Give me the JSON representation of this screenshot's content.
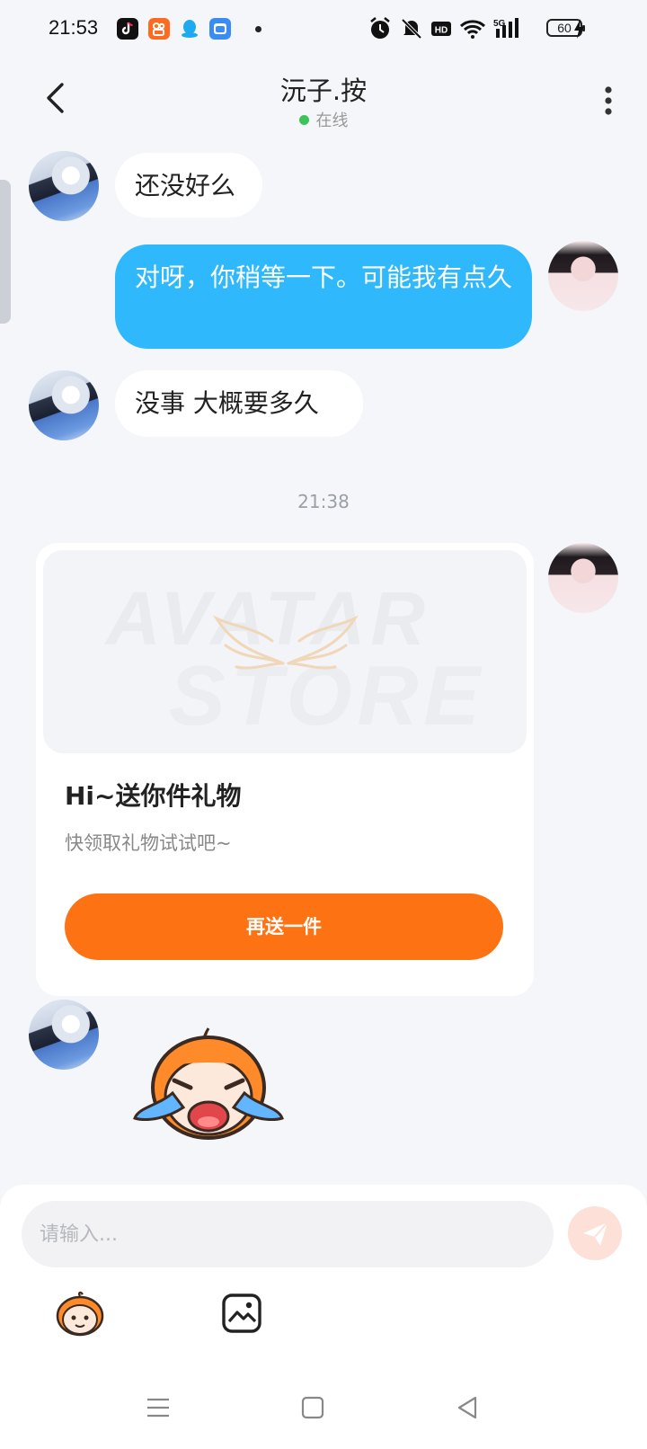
{
  "status_bar": {
    "time": "21:53",
    "network": "5G",
    "battery": "60",
    "hd_label": "HD"
  },
  "header": {
    "title": "沅子.按",
    "status": "在线"
  },
  "messages": [
    {
      "direction": "in",
      "text": "还没好么"
    },
    {
      "direction": "out",
      "text": "对呀，你稍等一下。可能我有点久"
    },
    {
      "direction": "in",
      "text": "没事 大概要多久"
    }
  ],
  "time_divider": "21:38",
  "gift_card": {
    "watermark_line1": "AVATAR",
    "watermark_line2": "STORE",
    "title": "Hi~送你件礼物",
    "subtitle": "快领取礼物试试吧~",
    "button_label": "再送一件"
  },
  "input": {
    "placeholder": "请输入..."
  },
  "colors": {
    "outgoing_bubble": "#2fb8fb",
    "gift_button": "#fd7314",
    "online": "#3cc45a",
    "send_button": "#fde0d7"
  },
  "icons": [
    "back-icon",
    "more-icon",
    "send-icon",
    "emoji-icon",
    "image-icon",
    "menu-icon",
    "home-icon",
    "back-nav-icon"
  ]
}
